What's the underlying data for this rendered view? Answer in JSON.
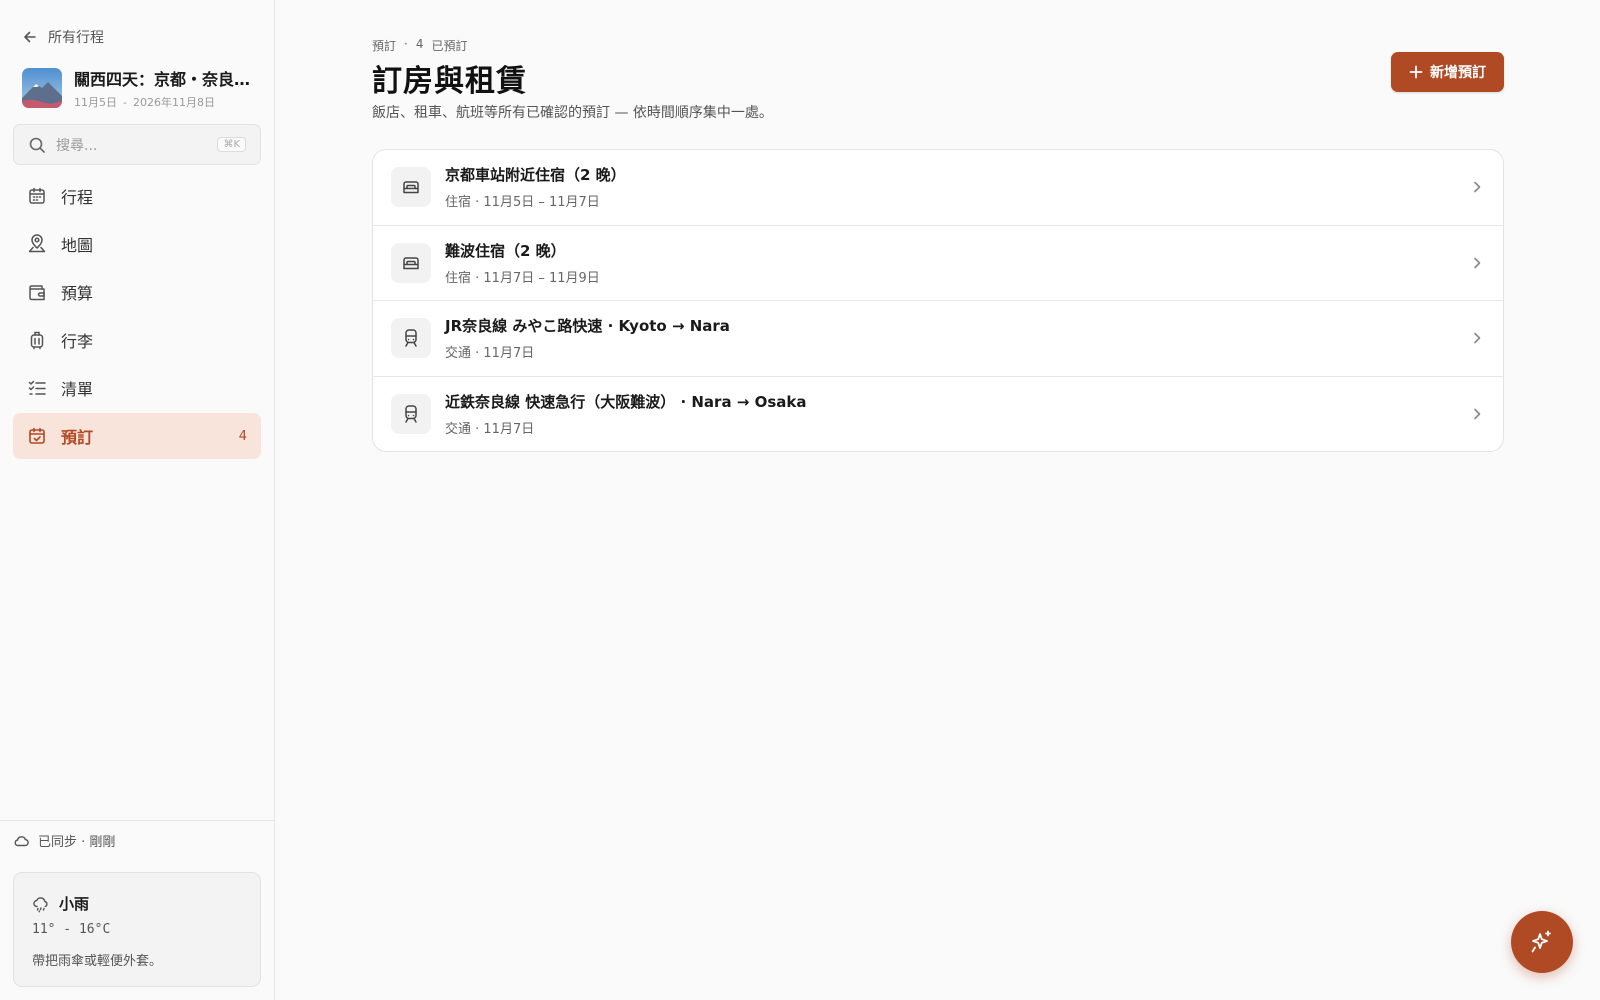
{
  "sidebar": {
    "back_label": "所有行程",
    "trip": {
      "title": "關西四天：京都・奈良…",
      "date_start": "11月5日",
      "date_sep": "-",
      "date_end": "2026年11月8日"
    },
    "search": {
      "placeholder": "搜尋...",
      "shortcut": "⌘K"
    },
    "nav": [
      {
        "label": "行程",
        "icon": "calendar-icon"
      },
      {
        "label": "地圖",
        "icon": "map-pin-icon"
      },
      {
        "label": "預算",
        "icon": "wallet-icon"
      },
      {
        "label": "行李",
        "icon": "luggage-icon"
      },
      {
        "label": "清單",
        "icon": "checklist-icon"
      },
      {
        "label": "預訂",
        "icon": "calendar-check-icon",
        "count": "4",
        "active": true
      }
    ],
    "sync_status": "已同步 · 剛剛",
    "weather": {
      "condition": "小雨",
      "temp": "11° - 16°C",
      "tip": "帶把雨傘或輕便外套。"
    }
  },
  "main": {
    "breadcrumb": {
      "section": "預訂",
      "dot": "·",
      "count": "4",
      "status": "已預訂"
    },
    "title": "訂房與租賃",
    "subtitle": "飯店、租車、航班等所有已確認的預訂 — 依時間順序集中一處。",
    "add_button_label": "新增預訂",
    "bookings": [
      {
        "title": "京都車站附近住宿（2 晚）",
        "meta": "住宿 · 11月5日 – 11月7日",
        "icon": "bed-icon"
      },
      {
        "title": "難波住宿（2 晚）",
        "meta": "住宿 · 11月7日 – 11月9日",
        "icon": "bed-icon"
      },
      {
        "title": "JR奈良線 みやこ路快速 · Kyoto → Nara",
        "meta": "交通 · 11月7日",
        "icon": "train-icon"
      },
      {
        "title": "近鉄奈良線 快速急行（大阪難波） · Nara → Osaka",
        "meta": "交通 · 11月7日",
        "icon": "train-icon"
      }
    ]
  },
  "colors": {
    "accent": "#b04a24",
    "accent_bg": "#f8e4db",
    "background": "#fafafa",
    "card": "#ffffff",
    "border": "#e3e3e3"
  }
}
